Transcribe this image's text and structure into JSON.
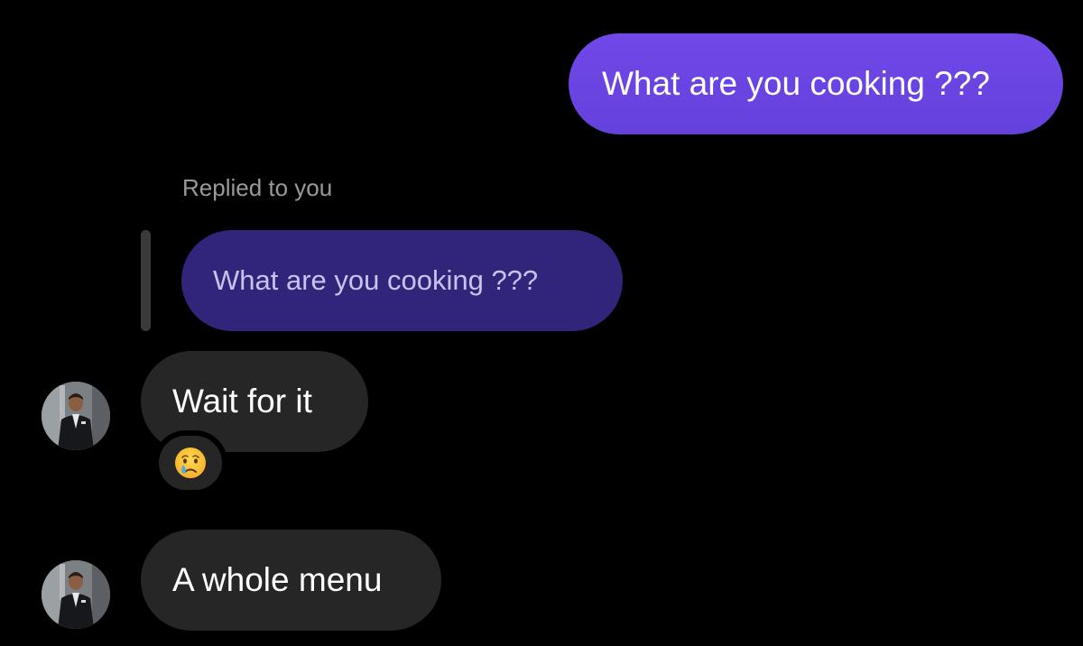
{
  "conversation": {
    "sent_message": "What are you cooking ???",
    "reply": {
      "label": "Replied to you",
      "quoted_text": "What are you cooking ???"
    },
    "received_messages": [
      {
        "text": "Wait for it",
        "reaction": "crying-face"
      },
      {
        "text": "A whole menu"
      }
    ]
  },
  "colors": {
    "sent_bubble": "#6e47e6",
    "quoted_bubble": "#30257a",
    "received_bubble": "#262626",
    "background": "#000000"
  },
  "icons": {
    "avatar": "avatar-icon",
    "reaction": "crying-face-icon"
  }
}
